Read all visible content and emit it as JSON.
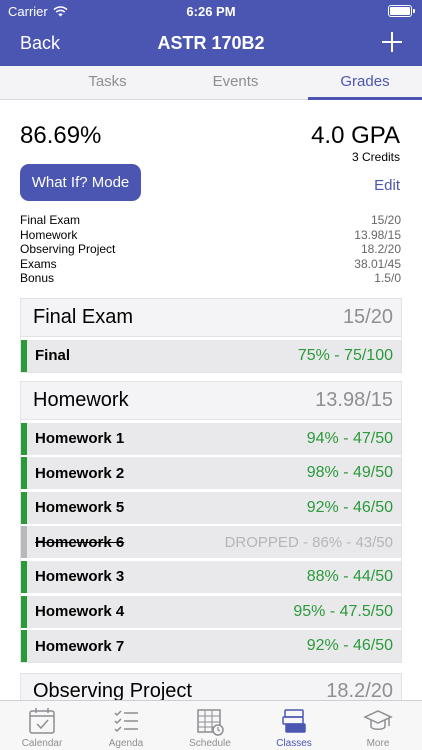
{
  "status_bar": {
    "carrier": "Carrier",
    "time": "6:26 PM"
  },
  "nav": {
    "back_label": "Back",
    "title": "ASTR 170B2",
    "add_icon": "plus-icon"
  },
  "tabs": [
    {
      "label": "Tasks",
      "active": false
    },
    {
      "label": "Events",
      "active": false
    },
    {
      "label": "Grades",
      "active": true
    }
  ],
  "summary": {
    "percent": "86.69%",
    "gpa": "4.0 GPA",
    "credits": "3 Credits",
    "whatif_label": "What If? Mode",
    "edit_label": "Edit",
    "rows": [
      {
        "name": "Final Exam",
        "value": "15/20"
      },
      {
        "name": "Homework",
        "value": "13.98/15"
      },
      {
        "name": "Observing Project",
        "value": "18.2/20"
      },
      {
        "name": "Exams",
        "value": "38.01/45"
      },
      {
        "name": "Bonus",
        "value": "1.5/0"
      }
    ]
  },
  "categories": [
    {
      "name": "Final Exam",
      "score": "15/20",
      "items": [
        {
          "name": "Final",
          "value": "75%  -  75/100",
          "dropped": false
        }
      ]
    },
    {
      "name": "Homework",
      "score": "13.98/15",
      "items": [
        {
          "name": "Homework 1",
          "value": "94%  -  47/50",
          "dropped": false
        },
        {
          "name": "Homework 2",
          "value": "98%  -  49/50",
          "dropped": false
        },
        {
          "name": "Homework 5",
          "value": "92%  -  46/50",
          "dropped": false
        },
        {
          "name": "Homework 6",
          "value": "DROPPED - 86%  -  43/50",
          "dropped": true
        },
        {
          "name": "Homework 3",
          "value": "88%  -  44/50",
          "dropped": false
        },
        {
          "name": "Homework 4",
          "value": "95%  -  47.5/50",
          "dropped": false
        },
        {
          "name": "Homework 7",
          "value": "92%  -  46/50",
          "dropped": false
        }
      ]
    },
    {
      "name": "Observing Project",
      "score": "18.2/20",
      "items": []
    }
  ],
  "tabbar": [
    {
      "label": "Calendar",
      "icon": "calendar-icon",
      "active": false
    },
    {
      "label": "Agenda",
      "icon": "checklist-icon",
      "active": false
    },
    {
      "label": "Schedule",
      "icon": "schedule-grid-icon",
      "active": false
    },
    {
      "label": "Classes",
      "icon": "books-icon",
      "active": true
    },
    {
      "label": "More",
      "icon": "graduation-cap-icon",
      "active": false
    }
  ],
  "colors": {
    "accent": "#4b56b3",
    "grade_green": "#2a9a3a",
    "dropped_gray": "#b8b8bc"
  }
}
